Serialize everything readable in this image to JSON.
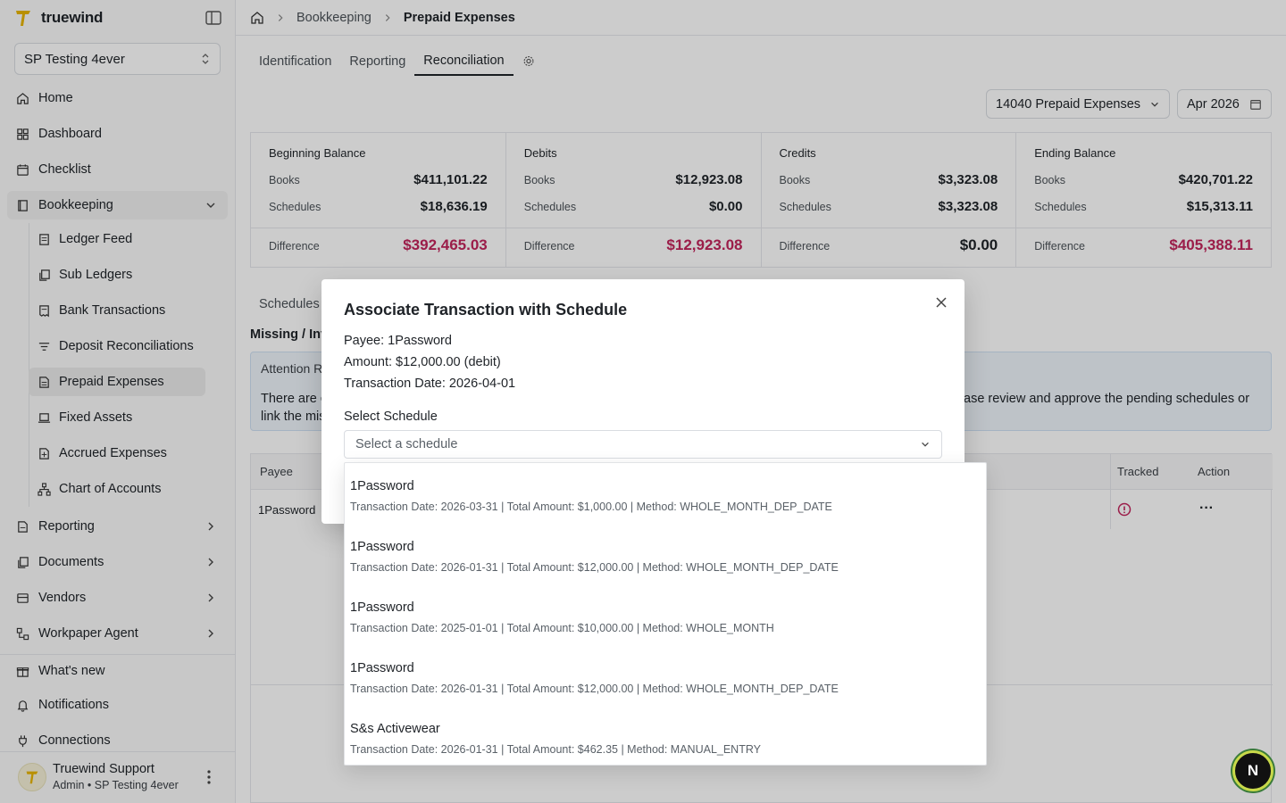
{
  "app": {
    "name": "truewind"
  },
  "org_selector": {
    "value": "SP Testing 4ever"
  },
  "nav": {
    "home": "Home",
    "dashboard": "Dashboard",
    "checklist": "Checklist",
    "bookkeeping": "Bookkeeping",
    "bookkeeping_items": [
      {
        "label": "Ledger Feed"
      },
      {
        "label": "Sub Ledgers"
      },
      {
        "label": "Bank Transactions"
      },
      {
        "label": "Deposit Reconciliations"
      },
      {
        "label": "Prepaid Expenses"
      },
      {
        "label": "Fixed Assets"
      },
      {
        "label": "Accrued Expenses"
      },
      {
        "label": "Chart of Accounts"
      }
    ],
    "reporting": "Reporting",
    "documents": "Documents",
    "vendors": "Vendors",
    "workpaper_agent": "Workpaper Agent",
    "whats_new": "What's new",
    "notifications": "Notifications",
    "connections": "Connections"
  },
  "user": {
    "name": "Truewind Support",
    "role": "Admin • SP Testing 4ever"
  },
  "breadcrumb": {
    "section": "Bookkeeping",
    "current": "Prepaid Expenses"
  },
  "tabs": {
    "identification": "Identification",
    "reporting": "Reporting",
    "reconciliation": "Reconciliation"
  },
  "filters": {
    "account": "14040 Prepaid Expenses",
    "period": "Apr 2026"
  },
  "cards": [
    {
      "title": "Beginning Balance",
      "books_label": "Books",
      "books": "$411,101.22",
      "schedules_label": "Schedules",
      "schedules": "$18,636.19",
      "diff_label": "Difference",
      "difference": "$392,465.03"
    },
    {
      "title": "Debits",
      "books_label": "Books",
      "books": "$12,923.08",
      "schedules_label": "Schedules",
      "schedules": "$0.00",
      "diff_label": "Difference",
      "difference": "$12,923.08"
    },
    {
      "title": "Credits",
      "books_label": "Books",
      "books": "$3,323.08",
      "schedules_label": "Schedules",
      "schedules": "$3,323.08",
      "diff_label": "Difference",
      "difference": "$0.00"
    },
    {
      "title": "Ending Balance",
      "books_label": "Books",
      "books": "$420,701.22",
      "schedules_label": "Schedules",
      "schedules": "$15,313.11",
      "diff_label": "Difference",
      "difference": "$405,388.11"
    }
  ],
  "background": {
    "schedules_tab": "Schedules",
    "missing_title": "Missing / Inv",
    "attention_title": "Attention R",
    "attention_line1_left": "There are c",
    "attention_line1_right": "ase review and approve the pending schedules or",
    "attention_line2_left": "link the mis",
    "table_headers": {
      "payee": "Payee",
      "tracked": "Tracked",
      "action": "Action"
    },
    "row_payee": "1Password",
    "row_more": "···"
  },
  "modal": {
    "title": "Associate Transaction with Schedule",
    "payee": "Payee: 1Password",
    "amount": "Amount: $12,000.00 (debit)",
    "date": "Transaction Date: 2026-04-01",
    "select_label": "Select Schedule",
    "select_placeholder": "Select a schedule"
  },
  "options": [
    {
      "name": "1Password",
      "detail": "Transaction Date: 2026-03-31 | Total Amount: $1,000.00 | Method: WHOLE_MONTH_DEP_DATE"
    },
    {
      "name": "1Password",
      "detail": "Transaction Date: 2026-01-31 | Total Amount: $12,000.00 | Method: WHOLE_MONTH_DEP_DATE"
    },
    {
      "name": "1Password",
      "detail": "Transaction Date: 2025-01-01 | Total Amount: $10,000.00 | Method: WHOLE_MONTH"
    },
    {
      "name": "1Password",
      "detail": "Transaction Date: 2026-01-31 | Total Amount: $12,000.00 | Method: WHOLE_MONTH_DEP_DATE"
    },
    {
      "name": "S&s Activewear",
      "detail": "Transaction Date: 2026-01-31 | Total Amount: $462.35 | Method: MANUAL_ENTRY"
    }
  ],
  "dev_badge": "N",
  "colors": {
    "accent": "#c2255c",
    "brand": "#e8b500"
  }
}
